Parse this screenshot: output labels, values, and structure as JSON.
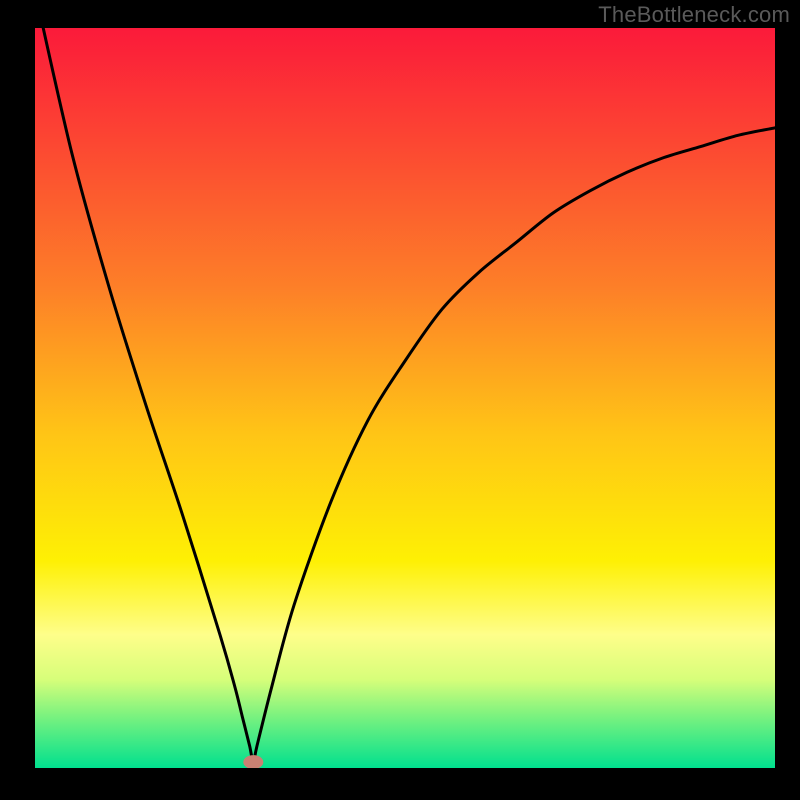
{
  "watermark": "TheBottleneck.com",
  "chart_data": {
    "type": "line",
    "title": "",
    "xlabel": "",
    "ylabel": "",
    "xlim": [
      0,
      100
    ],
    "ylim": [
      0,
      100
    ],
    "background_gradient_stops": [
      {
        "offset": 0.0,
        "color": "#fb1a3a"
      },
      {
        "offset": 0.35,
        "color": "#fd7f28"
      },
      {
        "offset": 0.55,
        "color": "#ffc516"
      },
      {
        "offset": 0.72,
        "color": "#fef004"
      },
      {
        "offset": 0.82,
        "color": "#fefe8a"
      },
      {
        "offset": 0.88,
        "color": "#d7fe7a"
      },
      {
        "offset": 0.93,
        "color": "#7af27f"
      },
      {
        "offset": 1.0,
        "color": "#00e08e"
      }
    ],
    "series": [
      {
        "name": "bottleneck-curve",
        "type": "line",
        "color": "#000000",
        "x": [
          0,
          5,
          10,
          15,
          20,
          25,
          27,
          28,
          29,
          29.5,
          30,
          32,
          35,
          40,
          45,
          50,
          55,
          60,
          65,
          70,
          75,
          80,
          85,
          90,
          95,
          100
        ],
        "values": [
          105,
          83,
          65,
          49,
          34,
          18,
          11,
          7,
          3,
          0.8,
          3,
          11,
          22,
          36,
          47,
          55,
          62,
          67,
          71,
          75,
          78,
          80.5,
          82.5,
          84,
          85.5,
          86.5
        ]
      }
    ],
    "marker": {
      "name": "optimal-point",
      "x": 29.5,
      "value": 0.8,
      "color": "#c98173",
      "rx": 10,
      "ry": 7
    }
  }
}
